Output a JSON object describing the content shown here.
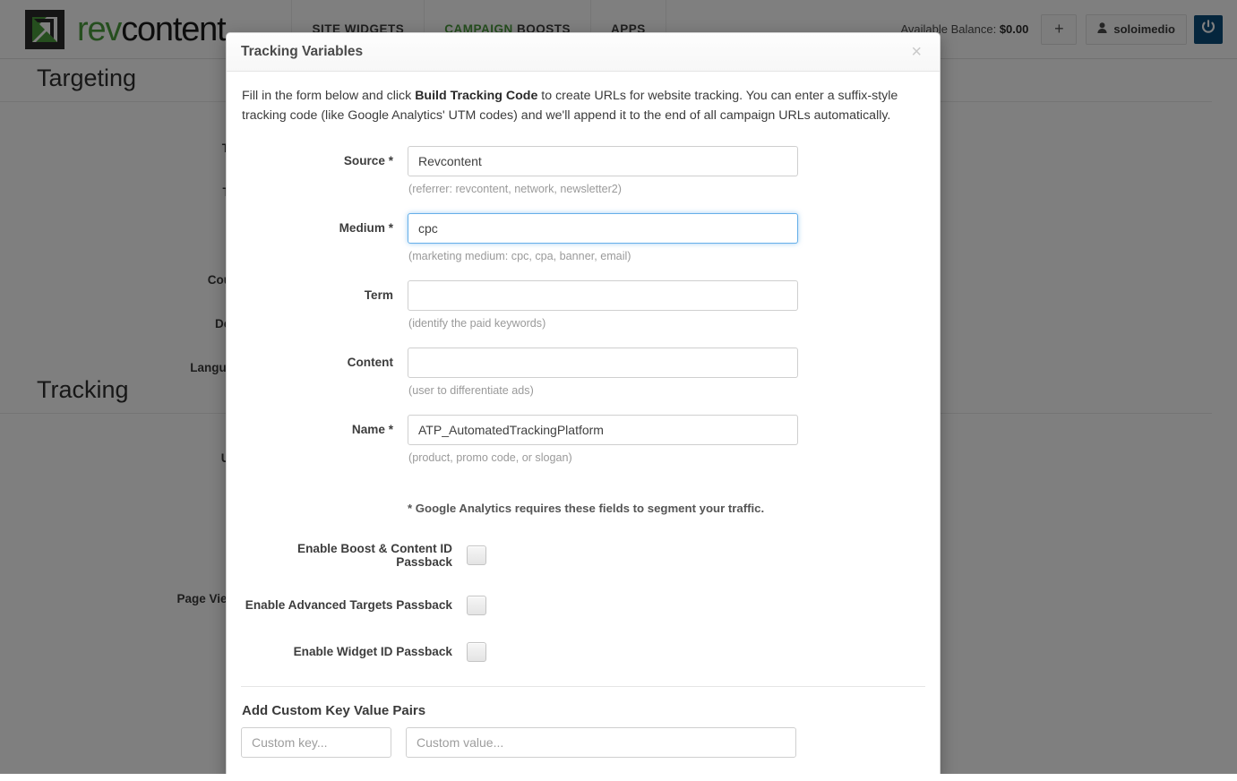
{
  "header": {
    "brand_rev": "rev",
    "brand_content": "content",
    "nav": [
      {
        "label": "SITE WIDGETS",
        "accent": ""
      },
      {
        "label_accent": "CAMPAIGN",
        "label_rest": " BOOSTS"
      },
      {
        "label": "APPS",
        "accent": ""
      }
    ],
    "nav_site_widgets": "SITE WIDGETS",
    "nav_campaign_accent": "CAMPAIGN",
    "nav_campaign_rest": "BOOSTS",
    "nav_apps": "APPS",
    "balance_label": "Available Balance:",
    "balance_value": "$0.00",
    "add_button": "+",
    "username": "soloimedio",
    "logout_icon": "power-icon"
  },
  "background": {
    "targeting_heading": "Targeting",
    "targeting_labels": [
      "Targ",
      "Topi",
      "Countr",
      "Devic",
      "Language"
    ],
    "tracking_heading": "Tracking",
    "tracking_labels": [
      "UTM",
      "Page View T"
    ]
  },
  "modal": {
    "title": "Tracking Variables",
    "close_label": "×",
    "intro_pre": "Fill in the form below and click ",
    "intro_bold": "Build Tracking Code",
    "intro_post": " to create URLs for website tracking. You can enter a suffix-style tracking code (like Google Analytics' UTM codes) and we'll append it to the end of all campaign URLs automatically.",
    "fields": [
      {
        "label": "Source *",
        "value": "Revcontent",
        "placeholder": "",
        "hint": "(referrer: revcontent, network, newsletter2)",
        "focused": false
      },
      {
        "label": "Medium *",
        "value": "cpc",
        "placeholder": "",
        "hint": "(marketing medium: cpc, cpa, banner, email)",
        "focused": true
      },
      {
        "label": "Term",
        "value": "",
        "placeholder": "",
        "hint": "(identify the paid keywords)",
        "focused": false
      },
      {
        "label": "Content",
        "value": "",
        "placeholder": "",
        "hint": "(user to differentiate ads)",
        "focused": false
      },
      {
        "label": "Name *",
        "value": "ATP_AutomatedTrackingPlatform",
        "placeholder": "",
        "hint": "(product, promo code, or slogan)",
        "focused": false
      }
    ],
    "ga_note": "* Google Analytics requires these fields to segment your traffic.",
    "toggles": [
      {
        "label": "Enable Boost & Content ID Passback",
        "checked": false
      },
      {
        "label": "Enable Advanced Targets Passback",
        "checked": false
      },
      {
        "label": "Enable Widget ID Passback",
        "checked": false
      }
    ],
    "custom_pairs": {
      "title": "Add Custom Key Value Pairs",
      "key_placeholder": "Custom key...",
      "value_placeholder": "Custom value...",
      "key_value": "",
      "value_value": ""
    }
  },
  "colors": {
    "brand_green": "#4a9c3c",
    "focus_blue": "#66afe9",
    "power_blue": "#0b4d7a"
  }
}
